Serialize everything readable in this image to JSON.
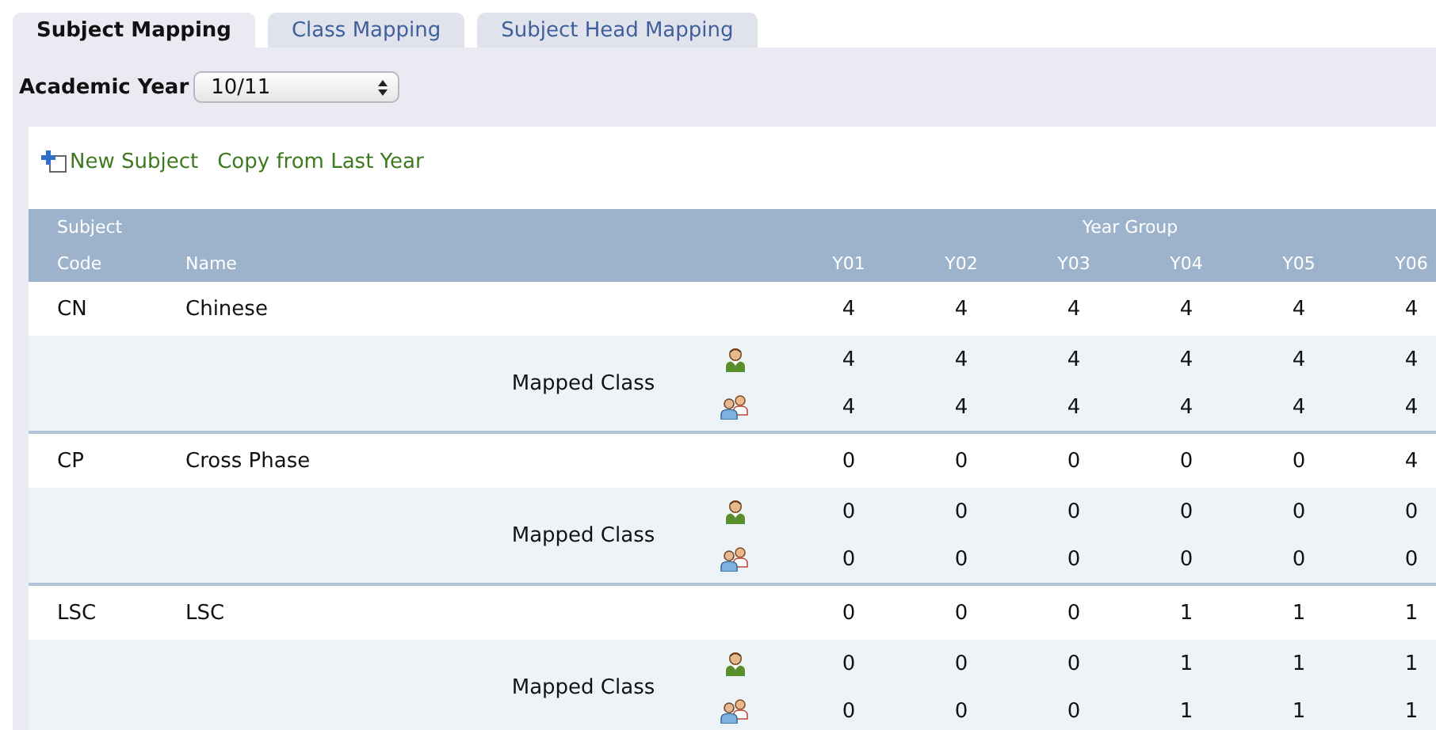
{
  "tabs": [
    {
      "label": "Subject Mapping",
      "selected": true
    },
    {
      "label": "Class Mapping",
      "selected": false
    },
    {
      "label": "Subject Head Mapping",
      "selected": false
    }
  ],
  "academic_year": {
    "label": "Academic Year",
    "value": "10/11"
  },
  "actions": [
    {
      "kind": "add",
      "label": "New Subject"
    },
    {
      "kind": "link",
      "label": "Copy from Last Year"
    }
  ],
  "table": {
    "subject_heading": "Subject",
    "year_group_heading": "Year Group",
    "code_heading": "Code",
    "name_heading": "Name",
    "years": [
      "Y01",
      "Y02",
      "Y03",
      "Y04",
      "Y05",
      "Y06"
    ],
    "subjects": [
      {
        "code": "CN",
        "name": "Chinese",
        "totals": [
          "4",
          "4",
          "4",
          "4",
          "4",
          "4"
        ],
        "mapped_label": "Mapped Class",
        "mapped": [
          {
            "kind": "single",
            "values": [
              "4",
              "4",
              "4",
              "4",
              "4",
              "4"
            ]
          },
          {
            "kind": "group",
            "values": [
              "4",
              "4",
              "4",
              "4",
              "4",
              "4"
            ]
          }
        ]
      },
      {
        "code": "CP",
        "name": "Cross Phase",
        "totals": [
          "0",
          "0",
          "0",
          "0",
          "0",
          "4"
        ],
        "mapped_label": "Mapped Class",
        "mapped": [
          {
            "kind": "single",
            "values": [
              "0",
              "0",
              "0",
              "0",
              "0",
              "0"
            ]
          },
          {
            "kind": "group",
            "values": [
              "0",
              "0",
              "0",
              "0",
              "0",
              "0"
            ]
          }
        ]
      },
      {
        "code": "LSC",
        "name": "LSC",
        "totals": [
          "0",
          "0",
          "0",
          "1",
          "1",
          "1"
        ],
        "mapped_label": "Mapped Class",
        "mapped": [
          {
            "kind": "single",
            "values": [
              "0",
              "0",
              "0",
              "1",
              "1",
              "1"
            ]
          },
          {
            "kind": "group",
            "values": [
              "0",
              "0",
              "0",
              "1",
              "1",
              "1"
            ]
          }
        ]
      }
    ]
  }
}
